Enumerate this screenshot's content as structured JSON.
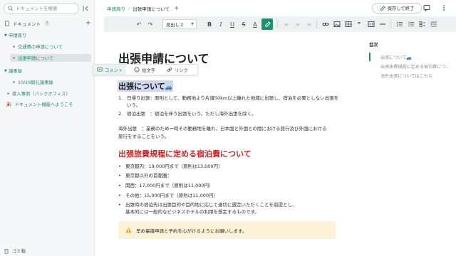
{
  "sidebar": {
    "search_placeholder": "ドキュメントを検索",
    "section_title": "ドキュメント",
    "section_count": "7",
    "items": [
      {
        "label": "申請周り"
      },
      {
        "label": "交通費の申請について"
      },
      {
        "label": "出張申請について"
      },
      {
        "label": "議事録"
      },
      {
        "label": "10/29朝礼議事録"
      },
      {
        "label": "導入事例（バックオフィス）"
      },
      {
        "label": "ドキュメント機能へようこそ"
      }
    ],
    "trash_label": "ゴミ箱"
  },
  "topbar": {
    "breadcrumb_parent": "申請周り",
    "breadcrumb_sep": "/",
    "breadcrumb_current": "出張申請について",
    "add": "+",
    "save_label": "保存して終了"
  },
  "toolbar": {
    "heading_value": "見出し２",
    "bold": "B",
    "italic": "I",
    "underline": "U",
    "strike": "S",
    "font_color": "A",
    "quote": "❞"
  },
  "float_toolbar": {
    "comment": "コメント",
    "emoji": "絵文字",
    "link": "リンク"
  },
  "document": {
    "title": "出張申請について",
    "h2_1": "出張について",
    "list_1": [
      {
        "num": "1.",
        "text": "日帰り出張：原則として、勤務地より片道50km以上離れた地域に出張し、宿泊を必要としない出張を"
      },
      {
        "num": "",
        "text": "いう。"
      },
      {
        "num": "2.",
        "text": "宿泊出張　：宿泊を伴う出張をいう。ただし海外出張を除く。"
      }
    ],
    "para_1_line1": "海外出張　：業務のため一時その勤務地を離れ、日本国と外国との間における旅行及び外国における",
    "para_1_line2": "旅行をすることをいう。",
    "h2_2": "出張旅費規程に定める宿泊費について",
    "bullets": [
      "東京都内：19,000円まで（原則は13,000円）",
      "東京都以外の首都圏：",
      "関西：17,000円まで（原則は11,000円）",
      "その他：15,000円まで（原則は11,000円）",
      "出張時の宿泊先は出張目的や目的地に応じて適切に選定いただくことを前提とし、",
      "基本的には一般的なビジネスホテルの利用を想定するものです。"
    ],
    "callout": "早め裏議申請と予約を心がけるようにお願いします。"
  },
  "toc": {
    "title": "目次",
    "items": [
      "出張について",
      "出張旅費規程に定める宿泊費につ...",
      "海外出張についてはこちら"
    ]
  },
  "colors": {
    "accent": "#1f8f6d",
    "heading_red": "#c62828",
    "selection": "#cfd8ef",
    "callout_bg": "#fdf3d8"
  }
}
